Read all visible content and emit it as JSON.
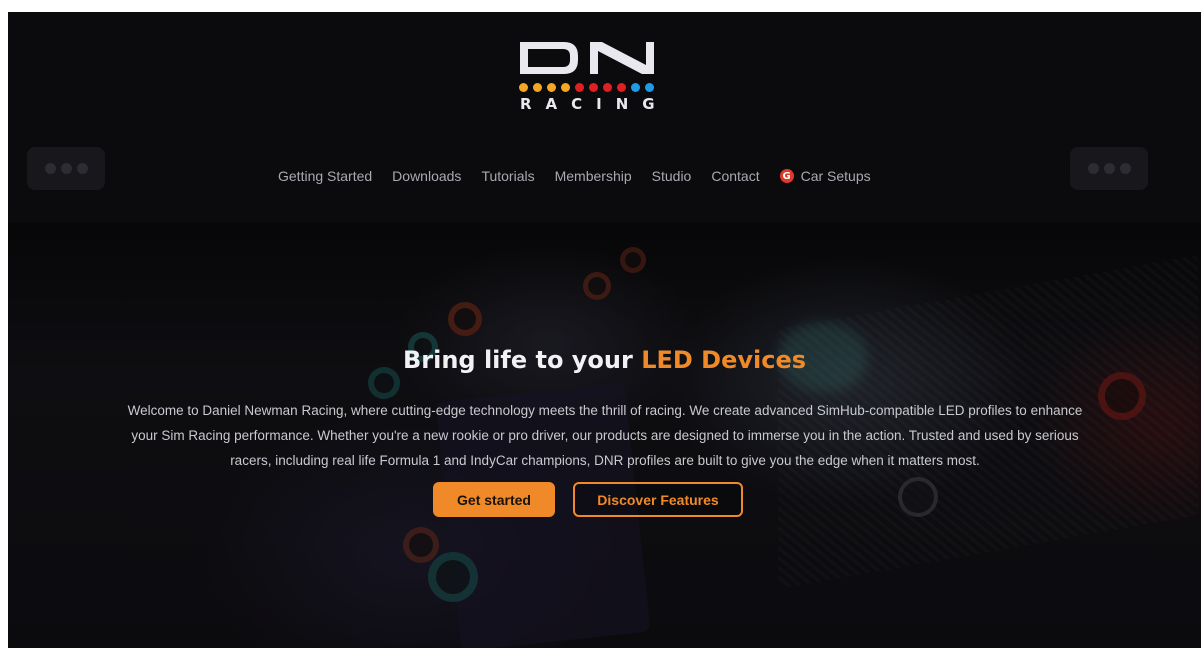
{
  "brand": {
    "logo_text": "DN",
    "logo_subtext": "RACING",
    "logo_dot_colors": [
      "#f5a623",
      "#f5a623",
      "#f5a623",
      "#f5a623",
      "#e02020",
      "#e02020",
      "#e02020",
      "#e02020",
      "#1e9be8",
      "#1e9be8"
    ]
  },
  "nav": {
    "items": [
      "Getting Started",
      "Downloads",
      "Tutorials",
      "Membership",
      "Studio",
      "Contact"
    ],
    "car_setups": {
      "icon": "g-logo-icon",
      "icon_glyph": "G",
      "label": "Car Setups"
    }
  },
  "hero": {
    "title_main": "Bring life to your",
    "title_accent": "LED Devices",
    "body": "Welcome to Daniel Newman Racing, where cutting-edge technology meets the thrill of racing. We create advanced SimHub-compatible LED profiles to enhance your Sim Racing performance. Whether you're a new rookie or pro driver, our products are designed to immerse you in the action. Trusted and used by serious racers, including real life Formula 1 and IndyCar champions, DNR profiles are built to give you the edge when it matters most.",
    "primary_button": "Get started",
    "secondary_button": "Discover Features"
  },
  "colors": {
    "accent": "#f08a28",
    "background": "#0b0b0d"
  }
}
